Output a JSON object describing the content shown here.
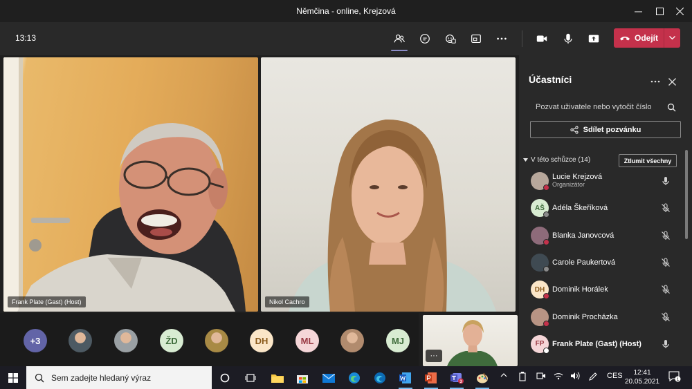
{
  "window": {
    "title": "Němčina - online, Krejzová",
    "minimize_icon": "minimize-icon",
    "maximize_icon": "maximize-icon",
    "close_icon": "close-icon"
  },
  "toolbar": {
    "timer": "13:13",
    "leave_label": "Odejít",
    "buttons": [
      "participants-icon",
      "chat-icon",
      "reactions-icon",
      "rooms-icon",
      "more-icon",
      "camera-icon",
      "mic-icon",
      "share-screen-icon",
      "phone-icon"
    ]
  },
  "video": {
    "tiles": [
      {
        "name": "Frank Plate (Gast) (Host)"
      },
      {
        "name": "Nikol Cachro"
      }
    ],
    "gallery": [
      {
        "label": "+3",
        "color": "#6264a7",
        "text_color": "#ffffff"
      },
      {
        "label": "",
        "color": "#4d5a63",
        "photo": true
      },
      {
        "label": "",
        "color": "#9aa0a4",
        "photo": true
      },
      {
        "label": "ŽD",
        "color": "#d8ecd2",
        "text_color": "#3d6b3a"
      },
      {
        "label": "",
        "color": "#a88a45",
        "photo": true
      },
      {
        "label": "DH",
        "color": "#fbe6c8",
        "text_color": "#8a5a1b"
      },
      {
        "label": "ML",
        "color": "#f5d6d8",
        "text_color": "#9a3b45"
      },
      {
        "label": "",
        "color": "#b18b6e",
        "photo": true
      },
      {
        "label": "MJ",
        "color": "#d8ecd2",
        "text_color": "#3d6b3a"
      }
    ],
    "self_more": "···"
  },
  "panel": {
    "title": "Účastníci",
    "invite_placeholder": "Pozvat uživatele nebo vytočit číslo",
    "share_label": "Sdílet pozvánku",
    "section_label": "V této schůzce (14)",
    "mute_all_label": "Ztlumit všechny",
    "participants": [
      {
        "name": "Lucie Krejzová",
        "role": "Organizátor",
        "initials": "",
        "avatar_color": "#b7a79b",
        "status": "#c4314b",
        "mic": "on"
      },
      {
        "name": "Adéla Škeříková",
        "initials": "AŠ",
        "avatar_color": "#d8ecd2",
        "text_color": "#3d6b3a",
        "status": "#8a8a8a",
        "mic": "off"
      },
      {
        "name": "Blanka Janovcová",
        "initials": "",
        "avatar_color": "#8e6b7a",
        "status": "#c4314b",
        "mic": "off"
      },
      {
        "name": "Carole Paukertová",
        "initials": "",
        "avatar_color": "#3f4a52",
        "status": "#8a8a8a",
        "mic": "off"
      },
      {
        "name": "Dominik Horálek",
        "initials": "DH",
        "avatar_color": "#fbe6c8",
        "text_color": "#8a5a1b",
        "status": "#c4314b",
        "mic": "off"
      },
      {
        "name": "Dominik Procházka",
        "initials": "",
        "avatar_color": "#b89484",
        "status": "#c4314b",
        "mic": "off"
      },
      {
        "name": "Frank Plate (Gast) (Host)",
        "initials": "FP",
        "avatar_color": "#f5d6d8",
        "text_color": "#9a3b45",
        "status": "#ffffff",
        "mic": "on",
        "bold": true
      }
    ]
  },
  "taskbar": {
    "search_placeholder": "Sem zadejte hledaný výraz",
    "language": "CES",
    "time": "12:41",
    "date": "20.05.2021",
    "teams_badge": "3",
    "notification_count": "1"
  }
}
